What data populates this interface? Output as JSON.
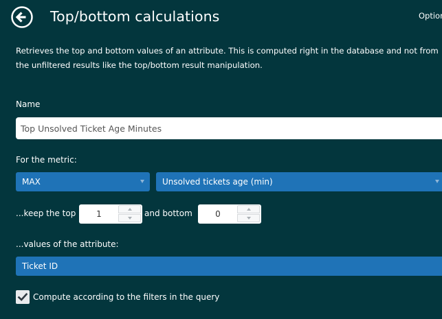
{
  "header": {
    "title": "Top/bottom calculations",
    "options_label": "Optior",
    "back_icon": "back-arrow-circle-icon"
  },
  "description": "Retrieves the top and bottom values of an attribute. This is computed right in the database and not from the unfiltered results like the top/bottom result manipulation.",
  "name_section": {
    "label": "Name",
    "value": "Top Unsolved Ticket Age Minutes"
  },
  "metric_section": {
    "label": "For the metric:",
    "aggregation": "MAX",
    "metric": "Unsolved tickets age (min)"
  },
  "keep_section": {
    "keep_top_label": "...keep the top",
    "top_value": "1",
    "bottom_label": "and bottom",
    "bottom_value": "0"
  },
  "attribute_section": {
    "label": "...values of the attribute:",
    "value": "Ticket ID"
  },
  "compute_filters": {
    "label": "Compute according to the filters in the query",
    "checked": true
  },
  "colors": {
    "background": "#03363d",
    "accent": "#1f73b7",
    "text": "#ffffff"
  }
}
